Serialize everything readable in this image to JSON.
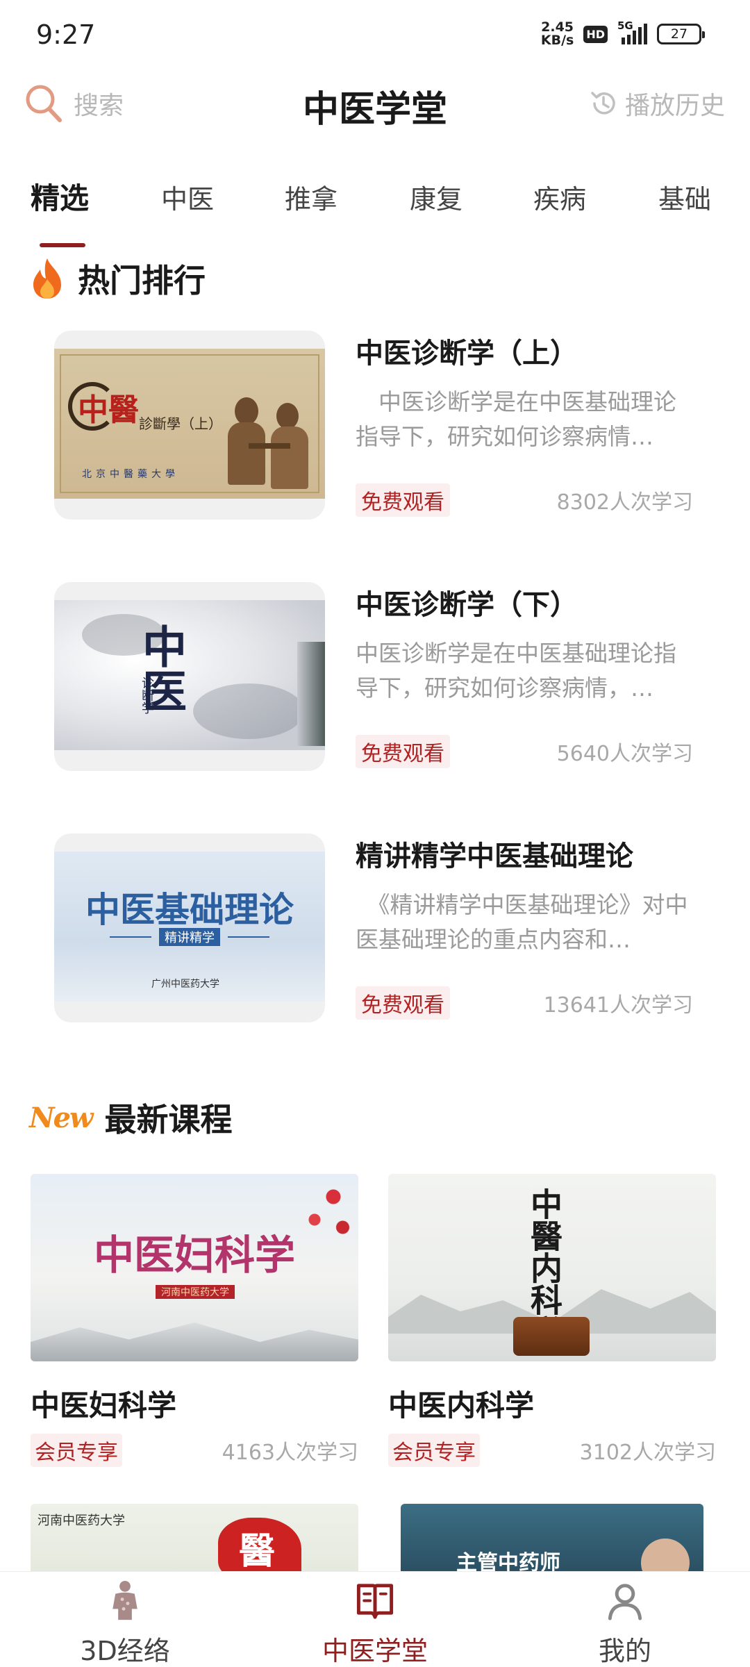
{
  "status_bar": {
    "time": "9:27",
    "net_speed_value": "2.45",
    "net_speed_unit": "KB/s",
    "hd": "HD",
    "network": "5G",
    "battery": "27"
  },
  "header": {
    "search_label": "搜索",
    "title": "中医学堂",
    "history_label": "播放历史"
  },
  "tabs": [
    {
      "label": "精选",
      "active": true
    },
    {
      "label": "中医",
      "active": false
    },
    {
      "label": "推拿",
      "active": false
    },
    {
      "label": "康复",
      "active": false
    },
    {
      "label": "疾病",
      "active": false
    },
    {
      "label": "基础",
      "active": false
    }
  ],
  "hot": {
    "title": "热门排行",
    "items": [
      {
        "title": "中医诊断学（上）",
        "desc": "　中医诊断学是在中医基础理论指导下，研究如何诊察病情…",
        "tag": "免费观看",
        "count": "8302人次学习",
        "thumb_text": "中醫",
        "thumb_sub": "診斷學（上）",
        "thumb_school": "北京中醫藥大學"
      },
      {
        "title": "中医诊断学（下）",
        "desc": " 中医诊断学是在中医基础理论指导下，研究如何诊察病情，…",
        "tag": "免费观看",
        "count": "5640人次学习",
        "thumb_text": "中医",
        "thumb_sub": "诊断学"
      },
      {
        "title": "精讲精学中医基础理论",
        "desc": "　《精讲精学中医基础理论》对中医基础理论的重点内容和…",
        "tag": "免费观看",
        "count": "13641人次学习",
        "thumb_text": "中医基础理论",
        "thumb_sub": "精讲精学",
        "thumb_school": "广州中医药大学"
      }
    ]
  },
  "newest": {
    "badge": "New",
    "title": "最新课程",
    "items": [
      {
        "title": "中医妇科学",
        "tag": "会员专享",
        "count": "4163人次学习",
        "thumb_text": "中医妇科学",
        "thumb_school": "河南中医药大学"
      },
      {
        "title": "中医内科学",
        "tag": "会员专享",
        "count": "3102人次学习",
        "thumb_text": "中醫内科学"
      }
    ],
    "more": [
      {
        "thumb_school": "河南中医药大学",
        "thumb_text": "醫"
      },
      {
        "thumb_text": "主管中药师"
      }
    ]
  },
  "nav": [
    {
      "label": "3D经络",
      "active": false
    },
    {
      "label": "中医学堂",
      "active": true
    },
    {
      "label": "我的",
      "active": false
    }
  ],
  "colors": {
    "accent": "#8f1f1f",
    "tag_red": "#b22222",
    "tag_bg": "#fbeeee",
    "muted": "#a8a8a8",
    "new_badge": "#f08a1d"
  }
}
